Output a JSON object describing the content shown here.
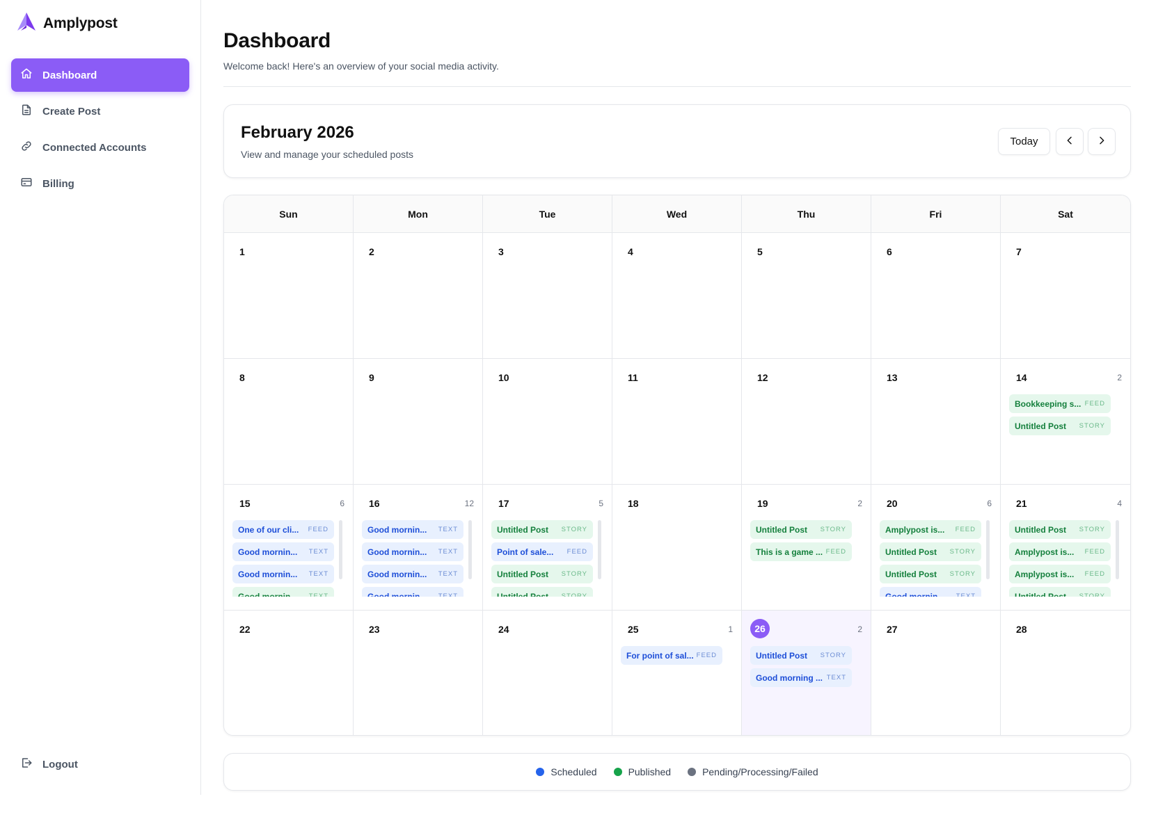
{
  "brand": {
    "name": "Amplypost",
    "accent": "#8b5cf6"
  },
  "sidebar": {
    "items": [
      {
        "label": "Dashboard",
        "icon": "home-icon",
        "active": true
      },
      {
        "label": "Create Post",
        "icon": "document-icon"
      },
      {
        "label": "Connected Accounts",
        "icon": "link-icon"
      },
      {
        "label": "Billing",
        "icon": "credit-card-icon"
      }
    ],
    "logout": {
      "label": "Logout",
      "icon": "logout-icon"
    }
  },
  "header": {
    "title": "Dashboard",
    "subtitle": "Welcome back! Here's an overview of your social media activity."
  },
  "month": {
    "title": "February 2026",
    "subtitle": "View and manage your scheduled posts",
    "today_label": "Today",
    "prev_icon": "chevron-left-icon",
    "next_icon": "chevron-right-icon"
  },
  "calendar": {
    "weekdays": [
      "Sun",
      "Mon",
      "Tue",
      "Wed",
      "Thu",
      "Fri",
      "Sat"
    ],
    "today": 26,
    "days": [
      {
        "day": "1",
        "count": "",
        "posts": []
      },
      {
        "day": "2",
        "count": "",
        "posts": []
      },
      {
        "day": "3",
        "count": "",
        "posts": []
      },
      {
        "day": "4",
        "count": "",
        "posts": []
      },
      {
        "day": "5",
        "count": "",
        "posts": []
      },
      {
        "day": "6",
        "count": "",
        "posts": []
      },
      {
        "day": "7",
        "count": "",
        "posts": []
      },
      {
        "day": "8",
        "count": "",
        "posts": []
      },
      {
        "day": "9",
        "count": "",
        "posts": []
      },
      {
        "day": "10",
        "count": "",
        "posts": []
      },
      {
        "day": "11",
        "count": "",
        "posts": []
      },
      {
        "day": "12",
        "count": "",
        "posts": []
      },
      {
        "day": "13",
        "count": "",
        "posts": []
      },
      {
        "day": "14",
        "count": "2",
        "posts": [
          {
            "title": "Bookkeeping s...",
            "kind": "FEED",
            "status": "green"
          },
          {
            "title": "Untitled Post",
            "kind": "STORY",
            "status": "green"
          }
        ]
      },
      {
        "day": "15",
        "count": "6",
        "scroll": true,
        "posts": [
          {
            "title": "One of our cli...",
            "kind": "FEED",
            "status": "blue"
          },
          {
            "title": "Good mornin...",
            "kind": "TEXT",
            "status": "blue"
          },
          {
            "title": "Good mornin...",
            "kind": "TEXT",
            "status": "blue"
          },
          {
            "title": "Good mornin...",
            "kind": "TEXT",
            "status": "green"
          }
        ]
      },
      {
        "day": "16",
        "count": "12",
        "scroll": true,
        "posts": [
          {
            "title": "Good mornin...",
            "kind": "TEXT",
            "status": "blue"
          },
          {
            "title": "Good mornin...",
            "kind": "TEXT",
            "status": "blue"
          },
          {
            "title": "Good mornin...",
            "kind": "TEXT",
            "status": "blue"
          },
          {
            "title": "Good mornin...",
            "kind": "TEXT",
            "status": "blue"
          }
        ]
      },
      {
        "day": "17",
        "count": "5",
        "scroll": true,
        "posts": [
          {
            "title": "Untitled Post",
            "kind": "STORY",
            "status": "green"
          },
          {
            "title": "Point of sale...",
            "kind": "FEED",
            "status": "blue"
          },
          {
            "title": "Untitled Post",
            "kind": "STORY",
            "status": "green"
          },
          {
            "title": "Untitled Post",
            "kind": "STORY",
            "status": "green"
          }
        ]
      },
      {
        "day": "18",
        "count": "",
        "posts": []
      },
      {
        "day": "19",
        "count": "2",
        "posts": [
          {
            "title": "Untitled Post",
            "kind": "STORY",
            "status": "green"
          },
          {
            "title": "This is a game ...",
            "kind": "FEED",
            "status": "green"
          }
        ]
      },
      {
        "day": "20",
        "count": "6",
        "scroll": true,
        "posts": [
          {
            "title": "Amplypost is...",
            "kind": "FEED",
            "status": "green"
          },
          {
            "title": "Untitled Post",
            "kind": "STORY",
            "status": "green"
          },
          {
            "title": "Untitled Post",
            "kind": "STORY",
            "status": "green"
          },
          {
            "title": "Good mornin...",
            "kind": "TEXT",
            "status": "blue"
          }
        ]
      },
      {
        "day": "21",
        "count": "4",
        "scroll": true,
        "posts": [
          {
            "title": "Untitled Post",
            "kind": "STORY",
            "status": "green"
          },
          {
            "title": "Amplypost is...",
            "kind": "FEED",
            "status": "green"
          },
          {
            "title": "Amplypost is...",
            "kind": "FEED",
            "status": "green"
          },
          {
            "title": "Untitled Post",
            "kind": "STORY",
            "status": "green"
          }
        ]
      },
      {
        "day": "22",
        "count": "",
        "posts": []
      },
      {
        "day": "23",
        "count": "",
        "posts": []
      },
      {
        "day": "24",
        "count": "",
        "posts": []
      },
      {
        "day": "25",
        "count": "1",
        "posts": [
          {
            "title": "For point of sal...",
            "kind": "FEED",
            "status": "blue"
          }
        ]
      },
      {
        "day": "26",
        "count": "2",
        "posts": [
          {
            "title": "Untitled Post",
            "kind": "STORY",
            "status": "blue"
          },
          {
            "title": "Good morning ...",
            "kind": "TEXT",
            "status": "blue"
          }
        ]
      },
      {
        "day": "27",
        "count": "",
        "posts": []
      },
      {
        "day": "28",
        "count": "",
        "posts": []
      }
    ]
  },
  "legend": [
    {
      "label": "Scheduled",
      "color": "#2563eb"
    },
    {
      "label": "Published",
      "color": "#16a34a"
    },
    {
      "label": "Pending/Processing/Failed",
      "color": "#6b7280"
    }
  ]
}
